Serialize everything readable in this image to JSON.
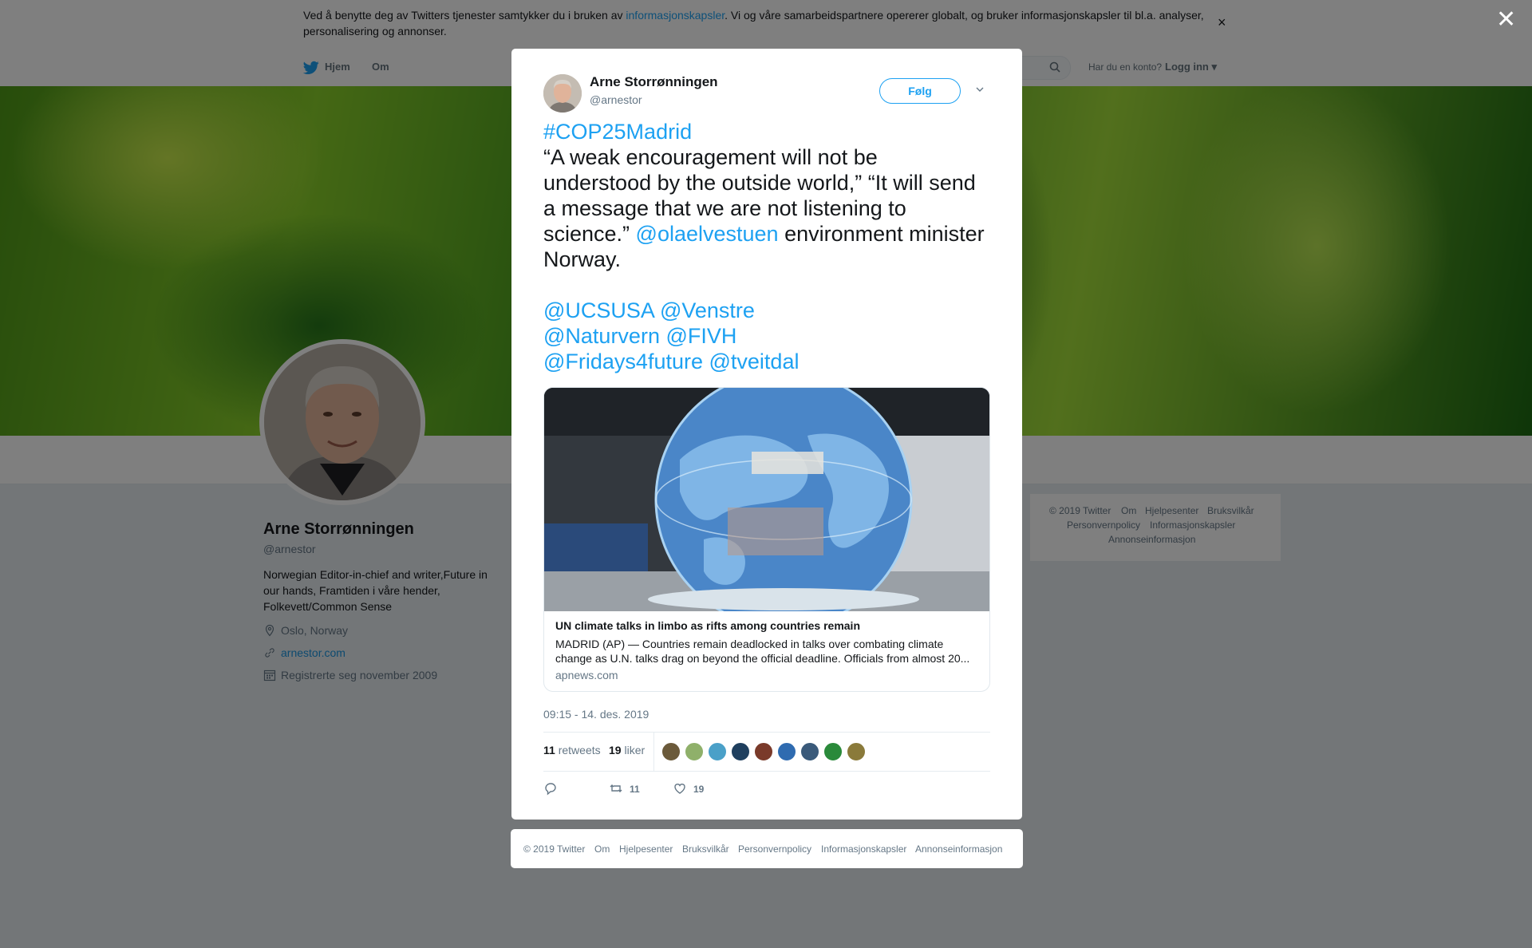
{
  "cookie_bar": {
    "text_before": "Ved å benytte deg av Twitters tjenester samtykker du i bruken av ",
    "link": "informasjonskapsler",
    "text_after": ". Vi og våre samarbeidspartnere opererer globalt, og bruker informasjonskapsler til bl.a. analyser, personalisering og annonser.",
    "close_icon": "close-icon"
  },
  "nav": {
    "home": "Hjem",
    "about": "Om",
    "account_question": "Har du en konto?",
    "login": "Logg inn"
  },
  "profile": {
    "name": "Arne Storrønningen",
    "handle": "@arnestor",
    "bio": "Norwegian Editor-in-chief and writer,Future in our hands, Framtiden i våre hender, Folkevett/Common Sense",
    "location": "Oslo, Norway",
    "website": "arnestor.com",
    "joined": "Registrerte seg november 2009"
  },
  "side_footer": [
    "© 2019 Twitter",
    "Om",
    "Hjelpesenter",
    "Bruksvilkår",
    "Personvernpolicy",
    "Informasjonskapsler",
    "Annonseinformasjon"
  ],
  "tweet": {
    "author_name": "Arne Storrønningen",
    "author_handle": "@arnestor",
    "follow_label": "Følg",
    "hashtag": "#COP25Madrid",
    "quote": "“A weak encouragement will not be understood by the outside world,”  “It will send a message that we are not listening to science.” ",
    "mention_main": "@olaelvestuen",
    "quote_tail": " environment minister Norway.",
    "mentions_line1": [
      "@UCSUSA",
      "@Venstre"
    ],
    "mentions_line2": [
      "@Naturvern",
      "@FIVH"
    ],
    "mentions_line3": [
      "@Fridays4future",
      "@tveitdal"
    ],
    "card": {
      "title": "UN climate talks in limbo as rifts among countries remain",
      "description": "MADRID (AP) — Countries remain deadlocked in talks over combating climate change as U.N. talks drag on beyond the official deadline. Officials from almost 20...",
      "domain": "apnews.com"
    },
    "timestamp": "09:15 - 14. des. 2019",
    "retweets_count": "11",
    "retweets_label": "retweets",
    "likes_count": "19",
    "likes_label": "liker",
    "likers_colors": [
      "#6b5a3a",
      "#8fb06a",
      "#4aa0c8",
      "#1f3f5e",
      "#7a3a2a",
      "#2f6bb0",
      "#3a5a7a",
      "#2a8a3a",
      "#8a7a3a"
    ],
    "actions": {
      "reply_icon": "reply-icon",
      "retweet_count": "11",
      "like_count": "19"
    }
  },
  "modal_footer": [
    "© 2019 Twitter",
    "Om",
    "Hjelpesenter",
    "Bruksvilkår",
    "Personvernpolicy",
    "Informasjonskapsler",
    "Annonseinformasjon"
  ]
}
